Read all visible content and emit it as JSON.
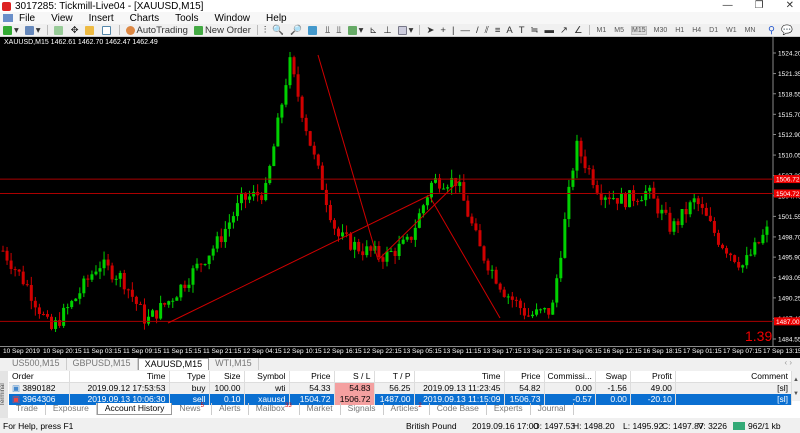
{
  "window": {
    "title": "3017285: Tickmill-Live04 - [XAUUSD,M15]"
  },
  "menu": [
    "File",
    "View",
    "Insert",
    "Charts",
    "Tools",
    "Window",
    "Help"
  ],
  "toolbar": {
    "autotrading": "AutoTrading",
    "new_order": "New Order",
    "timeframes": [
      "M1",
      "M5",
      "M15",
      "M30",
      "H1",
      "H4",
      "D1",
      "W1",
      "MN"
    ],
    "active_timeframe": "M15"
  },
  "chart": {
    "header": "XAUUSD,M15  1462.61 1462.70 1462.47 1462.49",
    "price_ticks": [
      "1524.20",
      "1521.35",
      "1518.55",
      "1515.70",
      "1512.90",
      "1510.05",
      "1507.20",
      "1504.40",
      "1501.55",
      "1498.70",
      "1495.90",
      "1493.05",
      "1490.25",
      "1487.40",
      "1484.55"
    ],
    "price_range": [
      1484.55,
      1524.2
    ],
    "level_labels": [
      "1506.72",
      "1504.72",
      "1487.00"
    ],
    "levels": [
      1506.72,
      1504.72,
      1487.0
    ],
    "overlay_value": "1.39",
    "time_labels": [
      "10 Sep 2019",
      "10 Sep 20:15",
      "11 Sep 03:15",
      "11 Sep 09:15",
      "11 Sep 15:15",
      "11 Sep 21:15",
      "12 Sep 04:15",
      "12 Sep 10:15",
      "12 Sep 16:15",
      "12 Sep 22:15",
      "13 Sep 05:15",
      "13 Sep 11:15",
      "13 Sep 17:15",
      "13 Sep 23:15",
      "16 Sep 06:15",
      "16 Sep 12:15",
      "16 Sep 18:15",
      "17 Sep 01:15",
      "17 Sep 07:15",
      "17 Sep 13:15"
    ],
    "path_prices": [
      1496.8,
      1492,
      1485.7,
      1490,
      1495,
      1493,
      1487,
      1490,
      1494,
      1498,
      1503.8,
      1505,
      1523,
      1510,
      1498.9,
      1497,
      1496,
      1498,
      1506.5,
      1506.5,
      1496.8,
      1491.2,
      1487.8,
      1488.5,
      1511.4,
      1505,
      1503.8,
      1505,
      1499.8,
      1503.8,
      1498.2,
      1494.7,
      1499.5
    ],
    "colors": {
      "up": "#00d000",
      "down": "#d00000",
      "line": "#d00000"
    }
  },
  "chart_tabs": [
    "US500,M15",
    "GBPUSD,M15",
    "XAUUSD,M15",
    "WTI,M15"
  ],
  "active_chart_tab": "XAUUSD,M15",
  "terminal": {
    "side_label": "Terminal",
    "columns": [
      "Order",
      "Time",
      "Type",
      "Size",
      "Symbol",
      "Price",
      "S / L",
      "T / P",
      "Time",
      "Price",
      "Commissi...",
      "Swap",
      "Profit",
      "Comment"
    ],
    "rows": [
      [
        "3890182",
        "2019.09.12 17:53:53",
        "buy",
        "100.00",
        "wti",
        "54.33",
        "54.83",
        "56.25",
        "2019.09.13 11:23:45",
        "54.82",
        "0.00",
        "-1.56",
        "49.00",
        "[sl]"
      ],
      [
        "3964306",
        "2019.09.13 10:06:30",
        "sell",
        "0.10",
        "xauusd",
        "1504.72",
        "1506.72",
        "1487.00",
        "2019.09.13 11:15:09",
        "1506.73",
        "-0.57",
        "0.00",
        "-20.10",
        "[sl]"
      ]
    ],
    "tabs": [
      {
        "label": "Trade"
      },
      {
        "label": "Exposure"
      },
      {
        "label": "Account History",
        "active": true
      },
      {
        "label": "News",
        "badge": "5"
      },
      {
        "label": "Alerts"
      },
      {
        "label": "Mailbox",
        "badge": "33"
      },
      {
        "label": "Market"
      },
      {
        "label": "Signals"
      },
      {
        "label": "Articles",
        "badge": "2"
      },
      {
        "label": "Code Base"
      },
      {
        "label": "Experts"
      },
      {
        "label": "Journal"
      }
    ]
  },
  "status": {
    "help": "For Help, press F1",
    "profile": "British Pound",
    "datetime": "2019.09.16 17:00",
    "open": "O: 1497.53",
    "high": "H: 1498.20",
    "low": "L: 1495.92",
    "close": "C: 1497.87",
    "volume": "V: 3226",
    "traffic": "962/1 kb"
  }
}
